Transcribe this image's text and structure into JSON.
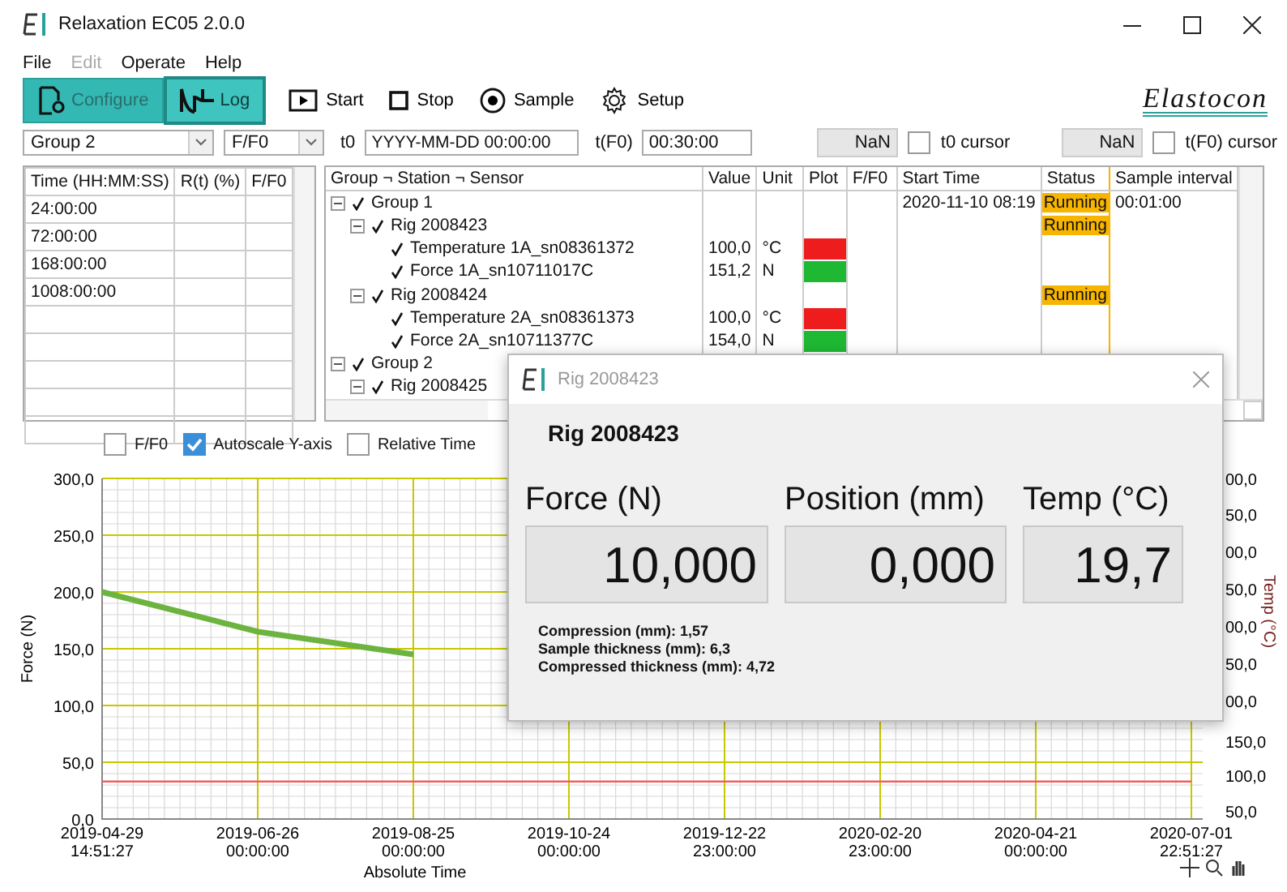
{
  "window": {
    "title": "Relaxation EC05 2.0.0"
  },
  "menu": [
    {
      "label": "File",
      "disabled": false
    },
    {
      "label": "Edit",
      "disabled": true
    },
    {
      "label": "Operate",
      "disabled": false
    },
    {
      "label": "Help",
      "disabled": false
    }
  ],
  "tabs": [
    {
      "label": "Configure",
      "selected": false
    },
    {
      "label": "Log",
      "selected": true
    }
  ],
  "toolbar_buttons": [
    "Start",
    "Stop",
    "Sample",
    "Setup"
  ],
  "brand": "Elastocon",
  "controls": {
    "group": "Group 2",
    "mode": "F/F0",
    "t0_label": "t0",
    "t0_placeholder": "YYYY-MM-DD 00:00:00",
    "tf0_label": "t(F0)",
    "tf0_value": "00:30:00",
    "t0_reading": "NaN",
    "t0_cursor": {
      "label": "t0 cursor",
      "checked": false
    },
    "tf0_reading": "NaN",
    "tf0_cursor": {
      "label": "t(F0) cursor",
      "checked": false
    }
  },
  "time_table": {
    "columns": [
      "Time (HH:MM:SS)",
      "R(t) (%)",
      "F/F0"
    ],
    "rows": [
      "24:00:00",
      "72:00:00",
      "168:00:00",
      "1008:00:00"
    ]
  },
  "tree": {
    "columns": [
      "Group ¬ Station ¬ Sensor",
      "Value",
      "Unit",
      "Plot",
      "F/F0",
      "Start Time",
      "Status",
      "Sample interval"
    ],
    "items": [
      {
        "label": "Group 1",
        "checked": true,
        "expanded": true,
        "start_time": "2020-11-10 08:19",
        "status": "Running",
        "interval": "00:01:00",
        "children": [
          {
            "label": "Rig 2008423",
            "checked": true,
            "expanded": true,
            "status": "Running",
            "children": [
              {
                "label": "Temperature 1A_sn08361372",
                "checked": true,
                "value": "100,0",
                "unit": "°C",
                "color": "#ee1c1c"
              },
              {
                "label": "Force 1A_sn10711017C",
                "checked": true,
                "value": "151,2",
                "unit": "N",
                "color": "#1eb832"
              }
            ]
          },
          {
            "label": "Rig 2008424",
            "checked": true,
            "expanded": true,
            "status": "Running",
            "children": [
              {
                "label": "Temperature 2A_sn08361373",
                "checked": true,
                "value": "100,0",
                "unit": "°C",
                "color": "#ee1c1c"
              },
              {
                "label": "Force 2A_sn10711377C",
                "checked": true,
                "value": "154,0",
                "unit": "N",
                "color": "#1eb832"
              }
            ]
          }
        ]
      },
      {
        "label": "Group 2",
        "checked": true,
        "expanded": true,
        "children": [
          {
            "label": "Rig 2008425",
            "checked": true,
            "expanded": true
          }
        ]
      }
    ]
  },
  "chart_options": [
    {
      "label": "F/F0",
      "checked": false
    },
    {
      "label": "Autoscale Y-axis",
      "checked": true
    },
    {
      "label": "Relative Time",
      "checked": false
    }
  ],
  "chart": {
    "chart_data": {
      "type": "line",
      "xlabel": "Absolute Time",
      "ylabel": "Force (N)",
      "categories": [
        "2019-04-29 14:51:27",
        "2019-06-26 00:00:00",
        "2019-08-25 00:00:00",
        "2019-10-24 00:00:00",
        "2019-12-22 23:00:00",
        "2020-02-20 23:00:00",
        "2020-04-21 00:00:00",
        "2020-07-01 22:51:27"
      ],
      "series": [
        {
          "color": "#6db33f",
          "values": [
            200,
            165,
            145,
            null,
            null,
            null,
            null,
            null
          ]
        },
        {
          "color": "#f06060",
          "values": [
            33,
            33,
            33,
            33,
            33,
            33,
            33,
            33
          ]
        }
      ],
      "ylim": [
        0,
        300
      ],
      "grid": true,
      "yticks": [
        {
          "value": 0,
          "label": "0,0"
        },
        {
          "value": 50,
          "label": "50,0"
        },
        {
          "value": 100,
          "label": "100,0"
        },
        {
          "value": 150,
          "label": "150,0"
        },
        {
          "value": 200,
          "label": "200,0"
        },
        {
          "value": 250,
          "label": "250,0"
        },
        {
          "value": 300,
          "label": "300,0"
        }
      ]
    },
    "right_axis": {
      "label": "Temp (°C)",
      "ticks": [
        "00,0",
        "50,0",
        "00,0",
        "50,0",
        "00,0",
        "50,0",
        "00,0",
        "150,0",
        "100,0",
        "50,0"
      ]
    }
  },
  "popup": {
    "title": "Rig 2008423",
    "heading": "Rig 2008423",
    "readouts": [
      {
        "label": "Force (N)",
        "value": "10,000"
      },
      {
        "label": "Position (mm)",
        "value": "0,000"
      },
      {
        "label": "Temp (°C)",
        "value": "19,7"
      }
    ],
    "notes": [
      "Compression (mm): 1,57",
      "Sample thickness (mm): 6,3",
      "Compressed thickness (mm): 4,72"
    ]
  }
}
